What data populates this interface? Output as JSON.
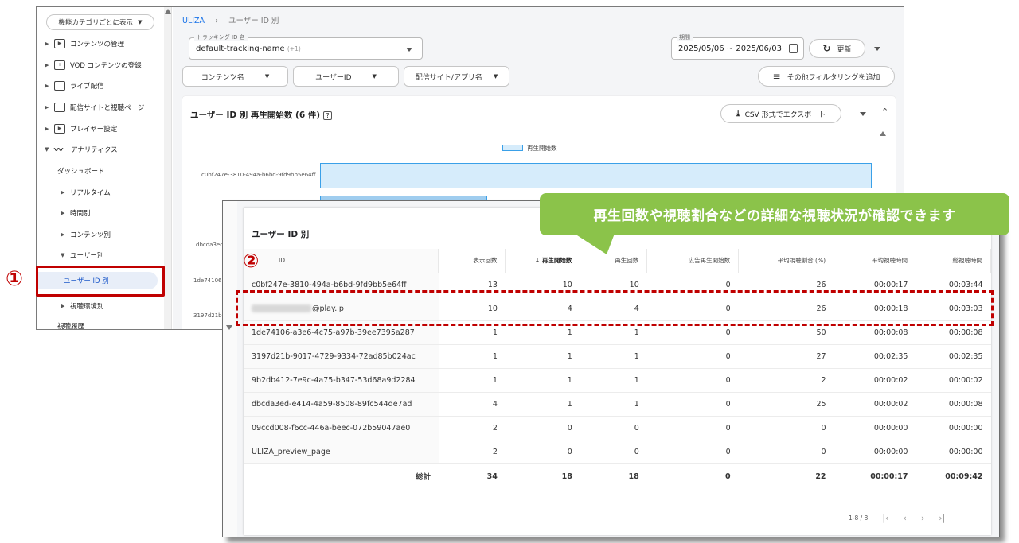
{
  "sidebar": {
    "category_button": "機能カテゴリごとに表示",
    "items": [
      {
        "label": "コンテンツの管理",
        "expanded": false
      },
      {
        "label": "VOD コンテンツの登録",
        "expanded": false
      },
      {
        "label": "ライブ配信",
        "expanded": false
      },
      {
        "label": "配信サイトと視聴ページ",
        "expanded": false
      },
      {
        "label": "プレイヤー設定",
        "expanded": false
      },
      {
        "label": "アナリティクス",
        "expanded": true
      }
    ],
    "analytics_items": [
      "ダッシュボード",
      "リアルタイム",
      "時間別",
      "コンテンツ別",
      "ユーザー別",
      "ユーザー ID 別",
      "視聴環境別",
      "視聴履歴"
    ],
    "selected": "ユーザー ID 別"
  },
  "breadcrumb": {
    "brand": "ULIZA",
    "sep": "›",
    "page": "ユーザー ID 別"
  },
  "tracking": {
    "label": "トラッキング ID 名",
    "value": "default-tracking-name",
    "extra": "(+1)"
  },
  "period": {
    "label": "期間",
    "value": "2025/05/06 ~ 2025/06/03"
  },
  "refresh_label": "更新",
  "filters": [
    "コンテンツ名",
    "ユーザーID",
    "配信サイト/アプリ名"
  ],
  "more_filter_label": "その他フィルタリングを追加",
  "card1": {
    "title": "ユーザー ID 別 再生開始数 (6 件)",
    "csv_label": "CSV 形式でエクスポート",
    "legend": "再生開始数",
    "y_labels": [
      "c0bf247e-3810-494a-b6bd-9fd9bb5e64ff",
      "dbcda3ed",
      "1de74106",
      "3197d21b"
    ]
  },
  "card2": {
    "title": "ユーザー ID 別",
    "columns": [
      "ID",
      "表示回数",
      "再生開始数",
      "再生回数",
      "広告再生開始数",
      "平均視聴割合 (%)",
      "平均視聴時間",
      "総視聴時間"
    ],
    "sorted_column": "再生開始数",
    "rows": [
      [
        "c0bf247e-3810-494a-b6bd-9fd9bb5e64ff",
        "13",
        "10",
        "10",
        "0",
        "26",
        "00:00:17",
        "00:03:44"
      ],
      [
        "@play.jp",
        "10",
        "4",
        "4",
        "0",
        "26",
        "00:00:18",
        "00:03:03"
      ],
      [
        "1de74106-a3e6-4c75-a97b-39ee7395a287",
        "1",
        "1",
        "1",
        "0",
        "50",
        "00:00:08",
        "00:00:08"
      ],
      [
        "3197d21b-9017-4729-9334-72ad85b024ac",
        "1",
        "1",
        "1",
        "0",
        "27",
        "00:02:35",
        "00:02:35"
      ],
      [
        "9b2db412-7e9c-4a75-b347-53d68a9d2284",
        "1",
        "1",
        "1",
        "0",
        "2",
        "00:00:02",
        "00:00:02"
      ],
      [
        "dbcda3ed-e414-4a59-8508-89fc544de7ad",
        "4",
        "1",
        "1",
        "0",
        "25",
        "00:00:02",
        "00:00:08"
      ],
      [
        "09ccd008-f6cc-446a-beec-072b59047ae0",
        "2",
        "0",
        "0",
        "0",
        "0",
        "00:00:00",
        "00:00:00"
      ],
      [
        "ULIZA_preview_page",
        "2",
        "0",
        "0",
        "0",
        "0",
        "00:00:00",
        "00:00:00"
      ]
    ],
    "total": [
      "総計",
      "34",
      "18",
      "18",
      "0",
      "22",
      "00:00:17",
      "00:09:42"
    ],
    "pager": "1-8 / 8"
  },
  "annotations": {
    "callout": "再生回数や視聴割合などの詳細な視聴状況が確認できます",
    "num1": "①",
    "num2": "②",
    "color": "#c00000",
    "callout_color": "#8bc34a"
  },
  "colors": {
    "accent": "#1a73e8",
    "bar_fill": "#d6ecfb",
    "bar_stroke": "#3aa0e8"
  }
}
